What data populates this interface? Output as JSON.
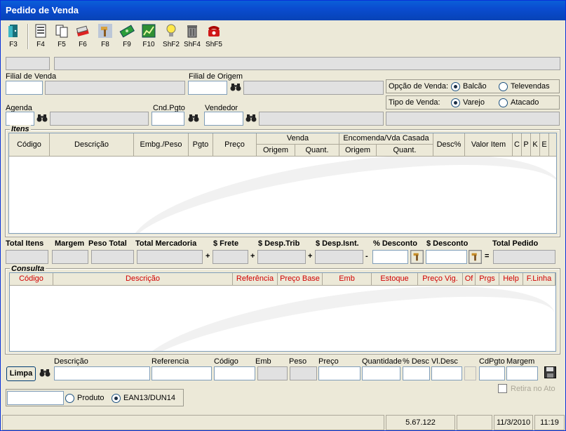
{
  "window": {
    "title": "Pedido de Venda"
  },
  "toolbar": [
    {
      "key": "F3",
      "icon": "exit-door-icon"
    },
    {
      "key": "F4",
      "icon": "notepad-icon"
    },
    {
      "key": "F5",
      "icon": "copy-pages-icon"
    },
    {
      "key": "F6",
      "icon": "eraser-icon"
    },
    {
      "key": "F8",
      "icon": "hammer-icon"
    },
    {
      "key": "F9",
      "icon": "money-icon"
    },
    {
      "key": "F10",
      "icon": "chart-icon"
    },
    {
      "key": "ShF2",
      "icon": "lightbulb-icon"
    },
    {
      "key": "ShF4",
      "icon": "trash-icon"
    },
    {
      "key": "ShF5",
      "icon": "telephone-icon"
    }
  ],
  "header": {
    "filial_venda": "Filial de Venda",
    "filial_origem": "Filial de Origem",
    "agenda": "Agenda",
    "cnd_pgto": "Cnd.Pgto",
    "vendedor": "Vendedor",
    "opcao_venda_label": "Opção de Venda:",
    "opcao_balcao": "Balcão",
    "opcao_televendas": "Televendas",
    "tipo_venda_label": "Tipo de Venda:",
    "tipo_varejo": "Varejo",
    "tipo_atacado": "Atacado"
  },
  "itens": {
    "legend": "Itens",
    "headers": {
      "codigo": "Código",
      "descricao": "Descrição",
      "embg_peso": "Embg./Peso",
      "pgto": "Pgto",
      "preco": "Preço",
      "venda": "Venda",
      "venda_origem": "Origem",
      "venda_quant": "Quant.",
      "encomenda": "Encomenda/Vda Casada",
      "enc_origem": "Origem",
      "enc_quant": "Quant.",
      "desc_pct": "Desc%",
      "valor_item": "Valor Item",
      "c": "C",
      "p": "P",
      "k": "K",
      "e": "E"
    }
  },
  "totals": {
    "total_itens": "Total Itens",
    "margem": "Margem",
    "peso_total": "Peso Total",
    "total_mercadoria": "Total Mercadoria",
    "frete": "$ Frete",
    "desp_trib": "$ Desp.Trib",
    "desp_isnt": "$ Desp.Isnt.",
    "pct_desconto": "% Desconto",
    "desconto": "$ Desconto",
    "total_pedido": "Total Pedido",
    "plus": "+",
    "minus": "-",
    "equals": "="
  },
  "consulta": {
    "legend": "Consulta",
    "headers": {
      "codigo": "Código",
      "descricao": "Descrição",
      "referencia": "Referência",
      "preco_base": "Preço Base",
      "emb": "Emb",
      "estoque": "Estoque",
      "preco_vig": "Preço Vig.",
      "of": "Of",
      "prgs": "Prgs",
      "help": "Help",
      "f_linha": "F.Linha"
    }
  },
  "search": {
    "limpa": "Limpa",
    "descricao": "Descrição",
    "referencia": "Referencia",
    "codigo": "Código",
    "emb": "Emb",
    "peso": "Peso",
    "preco": "Preço",
    "quantidade": "Quantidade",
    "pct_desc": "% Desc",
    "vl_desc": "Vl.Desc",
    "cdpgto": "CdPgto",
    "margem": "Margem",
    "retira_no_ato": "Retira no Ato",
    "produto": "Produto",
    "ean": "EAN13/DUN14"
  },
  "statusbar": {
    "version": "5.67.122",
    "date": "11/3/2010",
    "time": "11:19"
  }
}
